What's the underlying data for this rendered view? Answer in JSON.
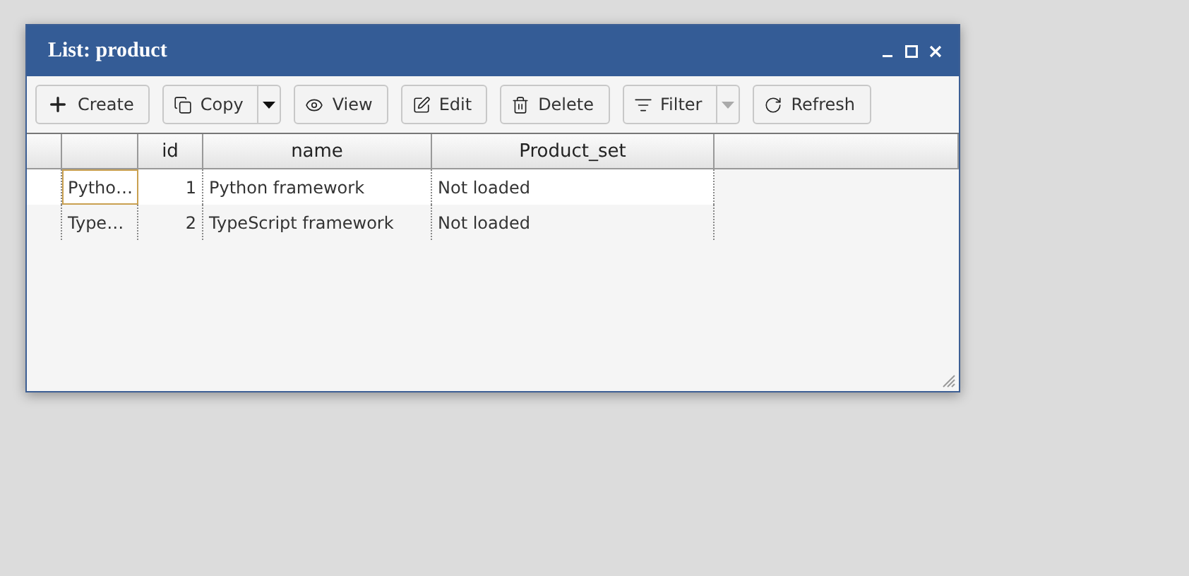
{
  "window": {
    "title": "List: product"
  },
  "toolbar": [
    {
      "label": "Create",
      "kind": "button"
    },
    {
      "label": "Copy",
      "kind": "split",
      "dropdown_disabled": false
    },
    {
      "label": "View",
      "kind": "button"
    },
    {
      "label": "Edit",
      "kind": "button"
    },
    {
      "label": "Delete",
      "kind": "button"
    },
    {
      "label": "Filter",
      "kind": "split",
      "dropdown_disabled": true
    },
    {
      "label": "Refresh",
      "kind": "button"
    }
  ],
  "table": {
    "columns": [
      "id",
      "name",
      "Product_set"
    ],
    "rows": [
      {
        "column_1": "Pytho…",
        "id": "1",
        "name": "Python framework",
        "product_set": "Not loaded",
        "selected": true
      },
      {
        "column_1": "Type…",
        "id": "2",
        "name": "TypeScript framework",
        "product_set": "Not loaded",
        "selected": false
      }
    ]
  }
}
